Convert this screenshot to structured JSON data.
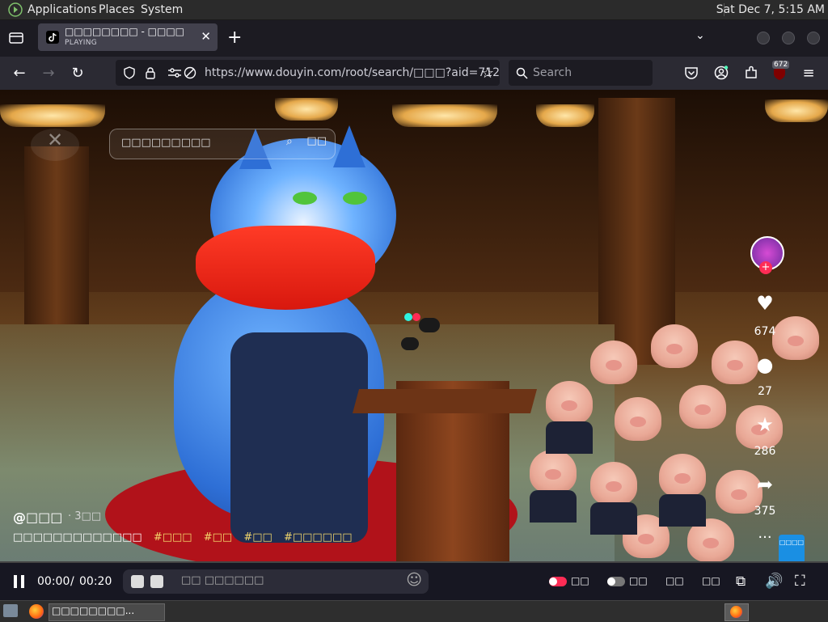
{
  "system_panel": {
    "menus": [
      "Applications",
      "Places",
      "System"
    ],
    "clock": "Sat Dec  7,  5:15 AM"
  },
  "browser": {
    "tab": {
      "title": "□□□□□□□□ - □□□□",
      "status": "PLAYING"
    },
    "url": "https://www.douyin.com/root/search/□□□?aid=712",
    "search_placeholder": "Search",
    "extension_badge": "672"
  },
  "video_overlay": {
    "search_placeholder": "□□□□□□□□□",
    "search_button": "□□"
  },
  "actions": {
    "likes": "674",
    "comments": "27",
    "favorites": "286",
    "shares": "375",
    "more": "···",
    "corner_badge": "□□□□"
  },
  "caption": {
    "author": "@□□□",
    "time": "· 3□□",
    "description": "□□□□□□□□□□□□□",
    "hashtags": [
      "#□□□",
      "#□□",
      "#□□",
      "#□□□□□□"
    ]
  },
  "player": {
    "current_time": "00:00",
    "separator": "/",
    "duration": "00:20",
    "danmaku_placeholder": "□□ □□□□□□",
    "controls": [
      "□□",
      "□□",
      "□□",
      "□□"
    ]
  },
  "taskbar": {
    "window_title": "□□□□□□□□..."
  },
  "colors": {
    "accent_pink": "#fe2c55",
    "tab_active": "#42414d",
    "toolbar": "#2b2a33",
    "player_bar": "#171722"
  }
}
